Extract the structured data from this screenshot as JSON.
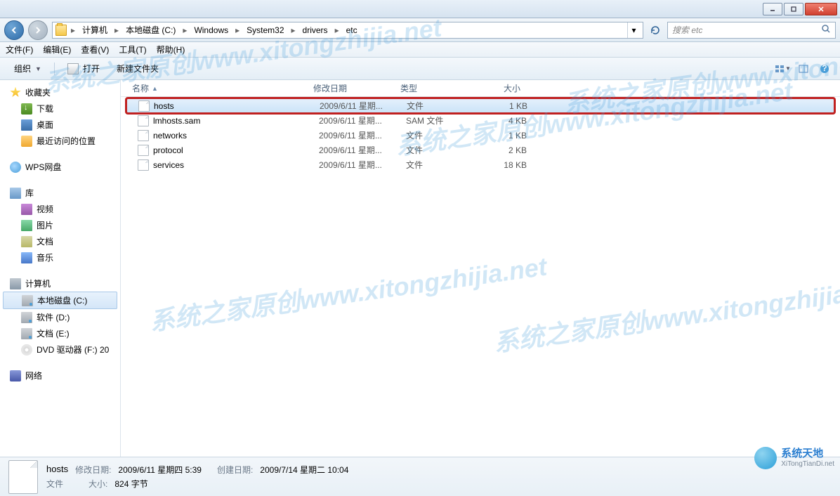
{
  "window": {
    "min": "最小化",
    "max": "最大化",
    "close": "关闭"
  },
  "breadcrumbs": [
    "计算机",
    "本地磁盘 (C:)",
    "Windows",
    "System32",
    "drivers",
    "etc"
  ],
  "search": {
    "placeholder": "搜索 etc"
  },
  "menubar": {
    "file": "文件(F)",
    "edit": "编辑(E)",
    "view": "查看(V)",
    "tools": "工具(T)",
    "help": "帮助(H)"
  },
  "toolbar": {
    "organize": "组织",
    "open": "打开",
    "newfolder": "新建文件夹"
  },
  "sidebar": {
    "favorites": "收藏夹",
    "downloads": "下载",
    "desktop": "桌面",
    "recent": "最近访问的位置",
    "wps": "WPS网盘",
    "libraries": "库",
    "videos": "视频",
    "pictures": "图片",
    "documents": "文档",
    "music": "音乐",
    "computer": "计算机",
    "drivec": "本地磁盘 (C:)",
    "drived": "软件 (D:)",
    "drivee": "文档 (E:)",
    "drivef": "DVD 驱动器 (F:) 20",
    "network": "网络"
  },
  "columns": {
    "name": "名称",
    "date": "修改日期",
    "type": "类型",
    "size": "大小"
  },
  "files": [
    {
      "name": "hosts",
      "date": "2009/6/11 星期...",
      "type": "文件",
      "size": "1 KB",
      "selected": true,
      "highlighted": true
    },
    {
      "name": "lmhosts.sam",
      "date": "2009/6/11 星期...",
      "type": "SAM 文件",
      "size": "4 KB"
    },
    {
      "name": "networks",
      "date": "2009/6/11 星期...",
      "type": "文件",
      "size": "1 KB"
    },
    {
      "name": "protocol",
      "date": "2009/6/11 星期...",
      "type": "文件",
      "size": "2 KB"
    },
    {
      "name": "services",
      "date": "2009/6/11 星期...",
      "type": "文件",
      "size": "18 KB"
    }
  ],
  "details": {
    "filename": "hosts",
    "mod_label": "修改日期:",
    "mod_value": "2009/6/11 星期四 5:39",
    "create_label": "创建日期:",
    "create_value": "2009/7/14 星期二 10:04",
    "type_value": "文件",
    "size_label": "大小:",
    "size_value": "824 字节"
  },
  "logo": {
    "line1": "系统天地",
    "line2": "XiTongTianDi.net"
  },
  "watermark": "系统之家原创www.xitongzhijia.net"
}
